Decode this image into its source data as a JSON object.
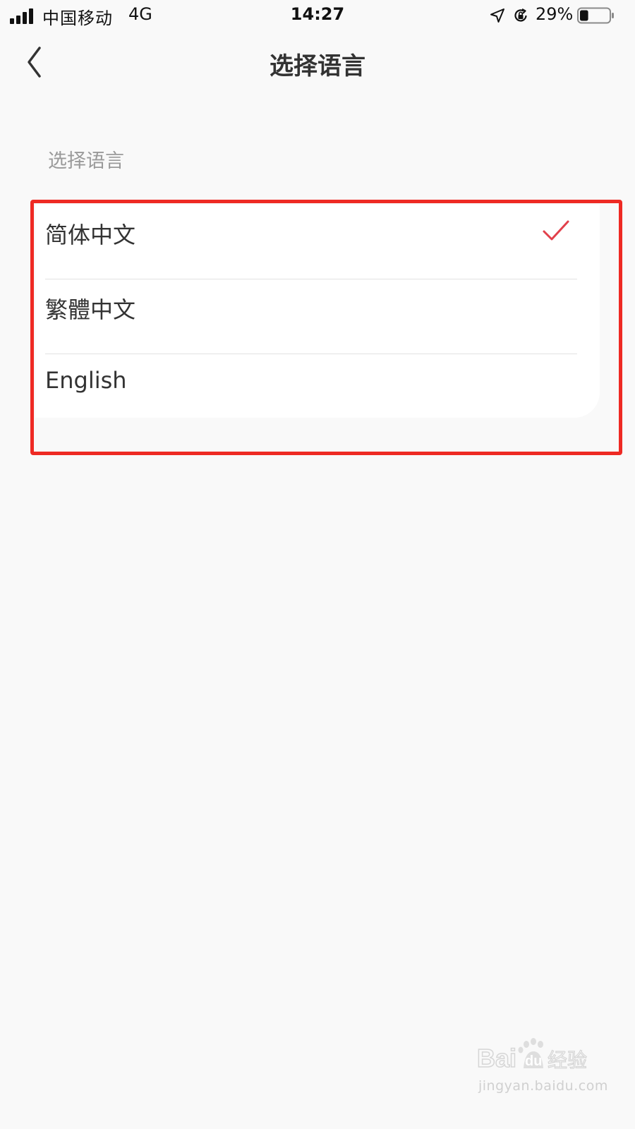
{
  "status_bar": {
    "carrier": "中国移动",
    "network": "4G",
    "time": "14:27",
    "battery_percent": "29%",
    "battery_level": 0.29,
    "icons": [
      "signal-icon",
      "location-icon",
      "rotation-lock-icon",
      "battery-icon"
    ]
  },
  "nav": {
    "title": "选择语言",
    "back_icon": "chevron-left-icon"
  },
  "section": {
    "label": "选择语言"
  },
  "languages": [
    {
      "label": "简体中文",
      "selected": true
    },
    {
      "label": "繁體中文",
      "selected": false
    },
    {
      "label": "English",
      "selected": false
    }
  ],
  "colors": {
    "accent": "#e2404b",
    "highlight_box": "#ee2a24",
    "background": "#f9f9f9",
    "card": "#ffffff"
  },
  "watermark": {
    "logo_text": "Baidu经验",
    "url": "jingyan.baidu.com"
  }
}
